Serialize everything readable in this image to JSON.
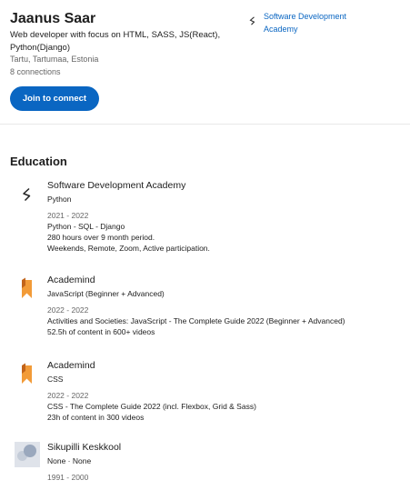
{
  "profile": {
    "name": "Jaanus Saar",
    "headline": "Web developer with focus on HTML, SASS, JS(React), Python(Django)",
    "location": "Tartu, Tartumaa, Estonia",
    "connections": "8 connections",
    "join_button": "Join to connect",
    "current_company": "Software Development Academy",
    "current_company_icon": "sda-logo-icon"
  },
  "education": {
    "title": "Education",
    "items": [
      {
        "school": "Software Development Academy",
        "degree": "Python",
        "dates": "2021 - 2022",
        "descriptions": [
          "Python - SQL - Django",
          "280 hours over 9 month period.",
          "Weekends, Remote, Zoom, Active participation."
        ],
        "logo": "sda-logo-icon"
      },
      {
        "school": "Academind",
        "degree": "JavaScript (Beginner + Advanced)",
        "dates": "2022 - 2022",
        "descriptions": [
          "Activities and Societies: JavaScript - The Complete Guide 2022 (Beginner + Advanced)",
          "52.5h of content in 600+ videos"
        ],
        "logo": "academind-bookmark-icon"
      },
      {
        "school": "Academind",
        "degree": "CSS",
        "dates": "2022 - 2022",
        "descriptions": [
          "CSS - The Complete Guide 2022 (incl. Flexbox, Grid & Sass)",
          "23h of content in 300 videos"
        ],
        "logo": "academind-bookmark-icon"
      },
      {
        "school": "Sikupilli Keskkool",
        "degree": "None · None",
        "dates": "1991 - 2000",
        "descriptions": [],
        "logo": "school-placeholder-icon"
      }
    ]
  },
  "colors": {
    "accent": "#0a66c2",
    "academind_orange": "#f29b38",
    "academind_dark": "#c2641a"
  }
}
